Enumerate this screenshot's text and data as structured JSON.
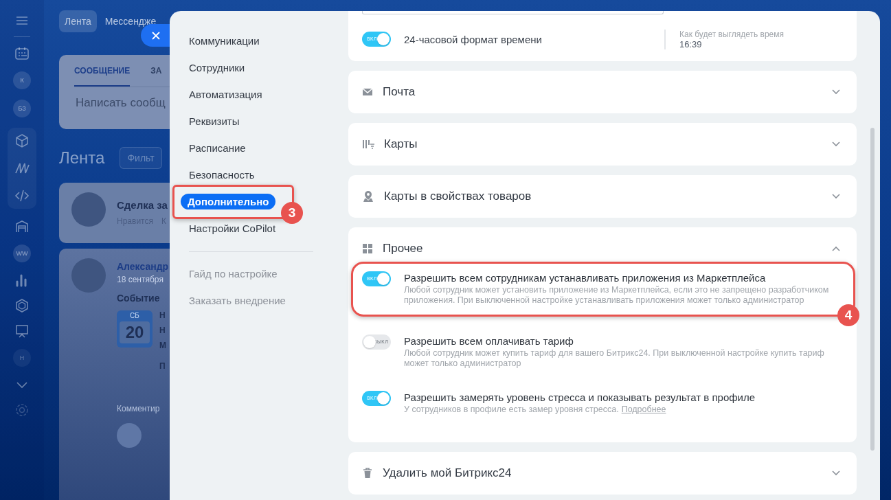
{
  "rail": {
    "badges": [
      "К",
      "БЗ",
      "WW",
      "Н"
    ]
  },
  "feed": {
    "top_tabs": [
      {
        "label": "Лента",
        "selected": true
      },
      {
        "label": "Мессендже",
        "selected": false
      }
    ],
    "composer": {
      "tabs": [
        {
          "label": "СООБЩЕНИЕ",
          "selected": true
        },
        {
          "label": "ЗА",
          "selected": false
        }
      ],
      "placeholder": "Написать сообщ"
    },
    "title": "Лента",
    "filter": "Фильт",
    "posts": [
      {
        "kind": "deal",
        "title": "Сделка за",
        "actions": [
          "Нравится",
          "К"
        ]
      },
      {
        "kind": "event",
        "author": "Александр",
        "date": "18 сентября",
        "heading": "Событие",
        "weekday": "СБ",
        "day": "20",
        "lines": [
          "Н",
          "Н",
          "М",
          "П"
        ],
        "comment": "Комментир"
      }
    ]
  },
  "settings_nav": {
    "items": [
      {
        "label": "Коммуникации",
        "selected": false
      },
      {
        "label": "Сотрудники",
        "selected": false
      },
      {
        "label": "Автоматизация",
        "selected": false
      },
      {
        "label": "Реквизиты",
        "selected": false
      },
      {
        "label": "Расписание",
        "selected": false
      },
      {
        "label": "Безопасность",
        "selected": false
      },
      {
        "label": "Дополнительно",
        "selected": true,
        "callout": "3"
      },
      {
        "label": "Настройки CoPilot",
        "selected": false
      }
    ],
    "links": [
      "Гайд по настройке",
      "Заказать внедрение"
    ]
  },
  "time_card": {
    "toggle": {
      "label": "24-часовой формат времени",
      "on": true,
      "state_text": "вкл"
    },
    "preview_label": "Как будет выглядеть время",
    "preview_value": "16:39"
  },
  "sections": [
    {
      "kind": "mail",
      "title": "Почта",
      "expanded": false
    },
    {
      "kind": "maps",
      "title": "Карты",
      "expanded": false
    },
    {
      "kind": "pin",
      "title": "Карты в свойствах товаров",
      "expanded": false
    },
    {
      "kind": "grid",
      "title": "Прочее",
      "expanded": true,
      "options": [
        {
          "title": "Разрешить всем сотрудникам устанавливать приложения из Маркетплейса",
          "description": "Любой сотрудник может установить приложение из Маркетплейса, если это не запрещено разработчиком приложения. При выключенной настройке устанавливать приложения может только администратор",
          "on": true,
          "state_text": "вкл",
          "callout": "4"
        },
        {
          "title": "Разрешить всем оплачивать тариф",
          "description": "Любой сотрудник может купить тариф для вашего Битрикс24. При выключенной настройке купить тариф может только администратор",
          "on": false,
          "state_text": "выкл"
        },
        {
          "title": "Разрешить замерять уровень стресса и показывать результат в профиле",
          "description": "У сотрудников в профиле есть замер уровня стресса.",
          "link": "Подробнее",
          "on": true,
          "state_text": "вкл"
        }
      ]
    },
    {
      "kind": "trash",
      "title": "Удалить мой Битрикс24",
      "expanded": false
    }
  ]
}
